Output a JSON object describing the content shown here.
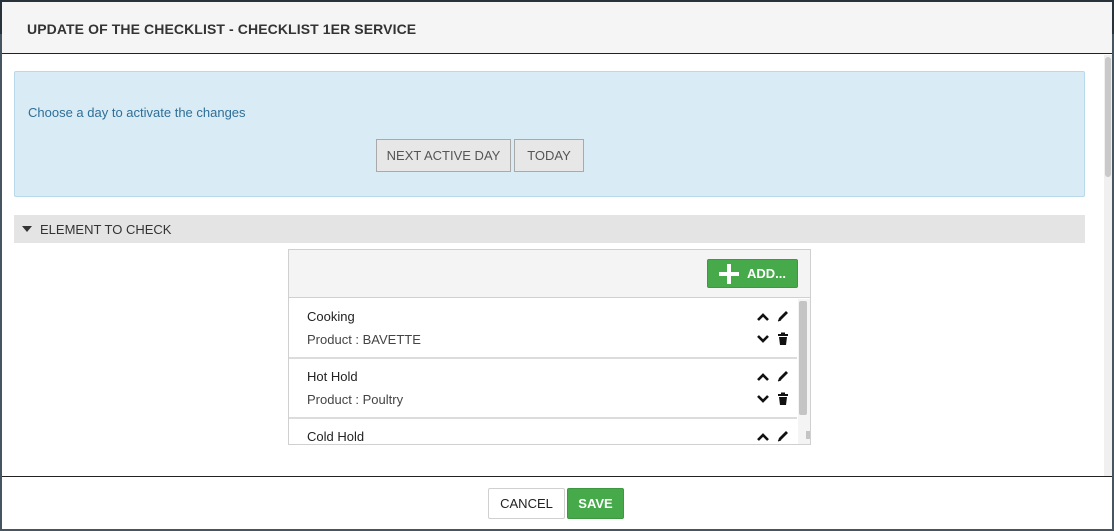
{
  "modal": {
    "title": "UPDATE OF THE CHECKLIST - CHECKLIST 1ER SERVICE"
  },
  "activation": {
    "prompt": "Choose a day to activate the changes",
    "next_active_day_label": "NEXT ACTIVE DAY",
    "today_label": "TODAY"
  },
  "section": {
    "title": "ELEMENT TO CHECK"
  },
  "list": {
    "add_label": "ADD...",
    "items": [
      {
        "name": "Cooking",
        "product": "Product : BAVETTE"
      },
      {
        "name": "Hot Hold",
        "product": "Product : Poultry"
      },
      {
        "name": "Cold Hold",
        "product": ""
      }
    ]
  },
  "footer": {
    "cancel_label": "CANCEL",
    "save_label": "SAVE"
  },
  "colors": {
    "accent_green": "#46a94a",
    "info_bg": "#d9ebf5",
    "info_text": "#2f6f98"
  },
  "icons": [
    "chevron-up-icon",
    "chevron-down-icon",
    "pencil-icon",
    "trash-icon",
    "plus-icon",
    "caret-down-icon"
  ]
}
